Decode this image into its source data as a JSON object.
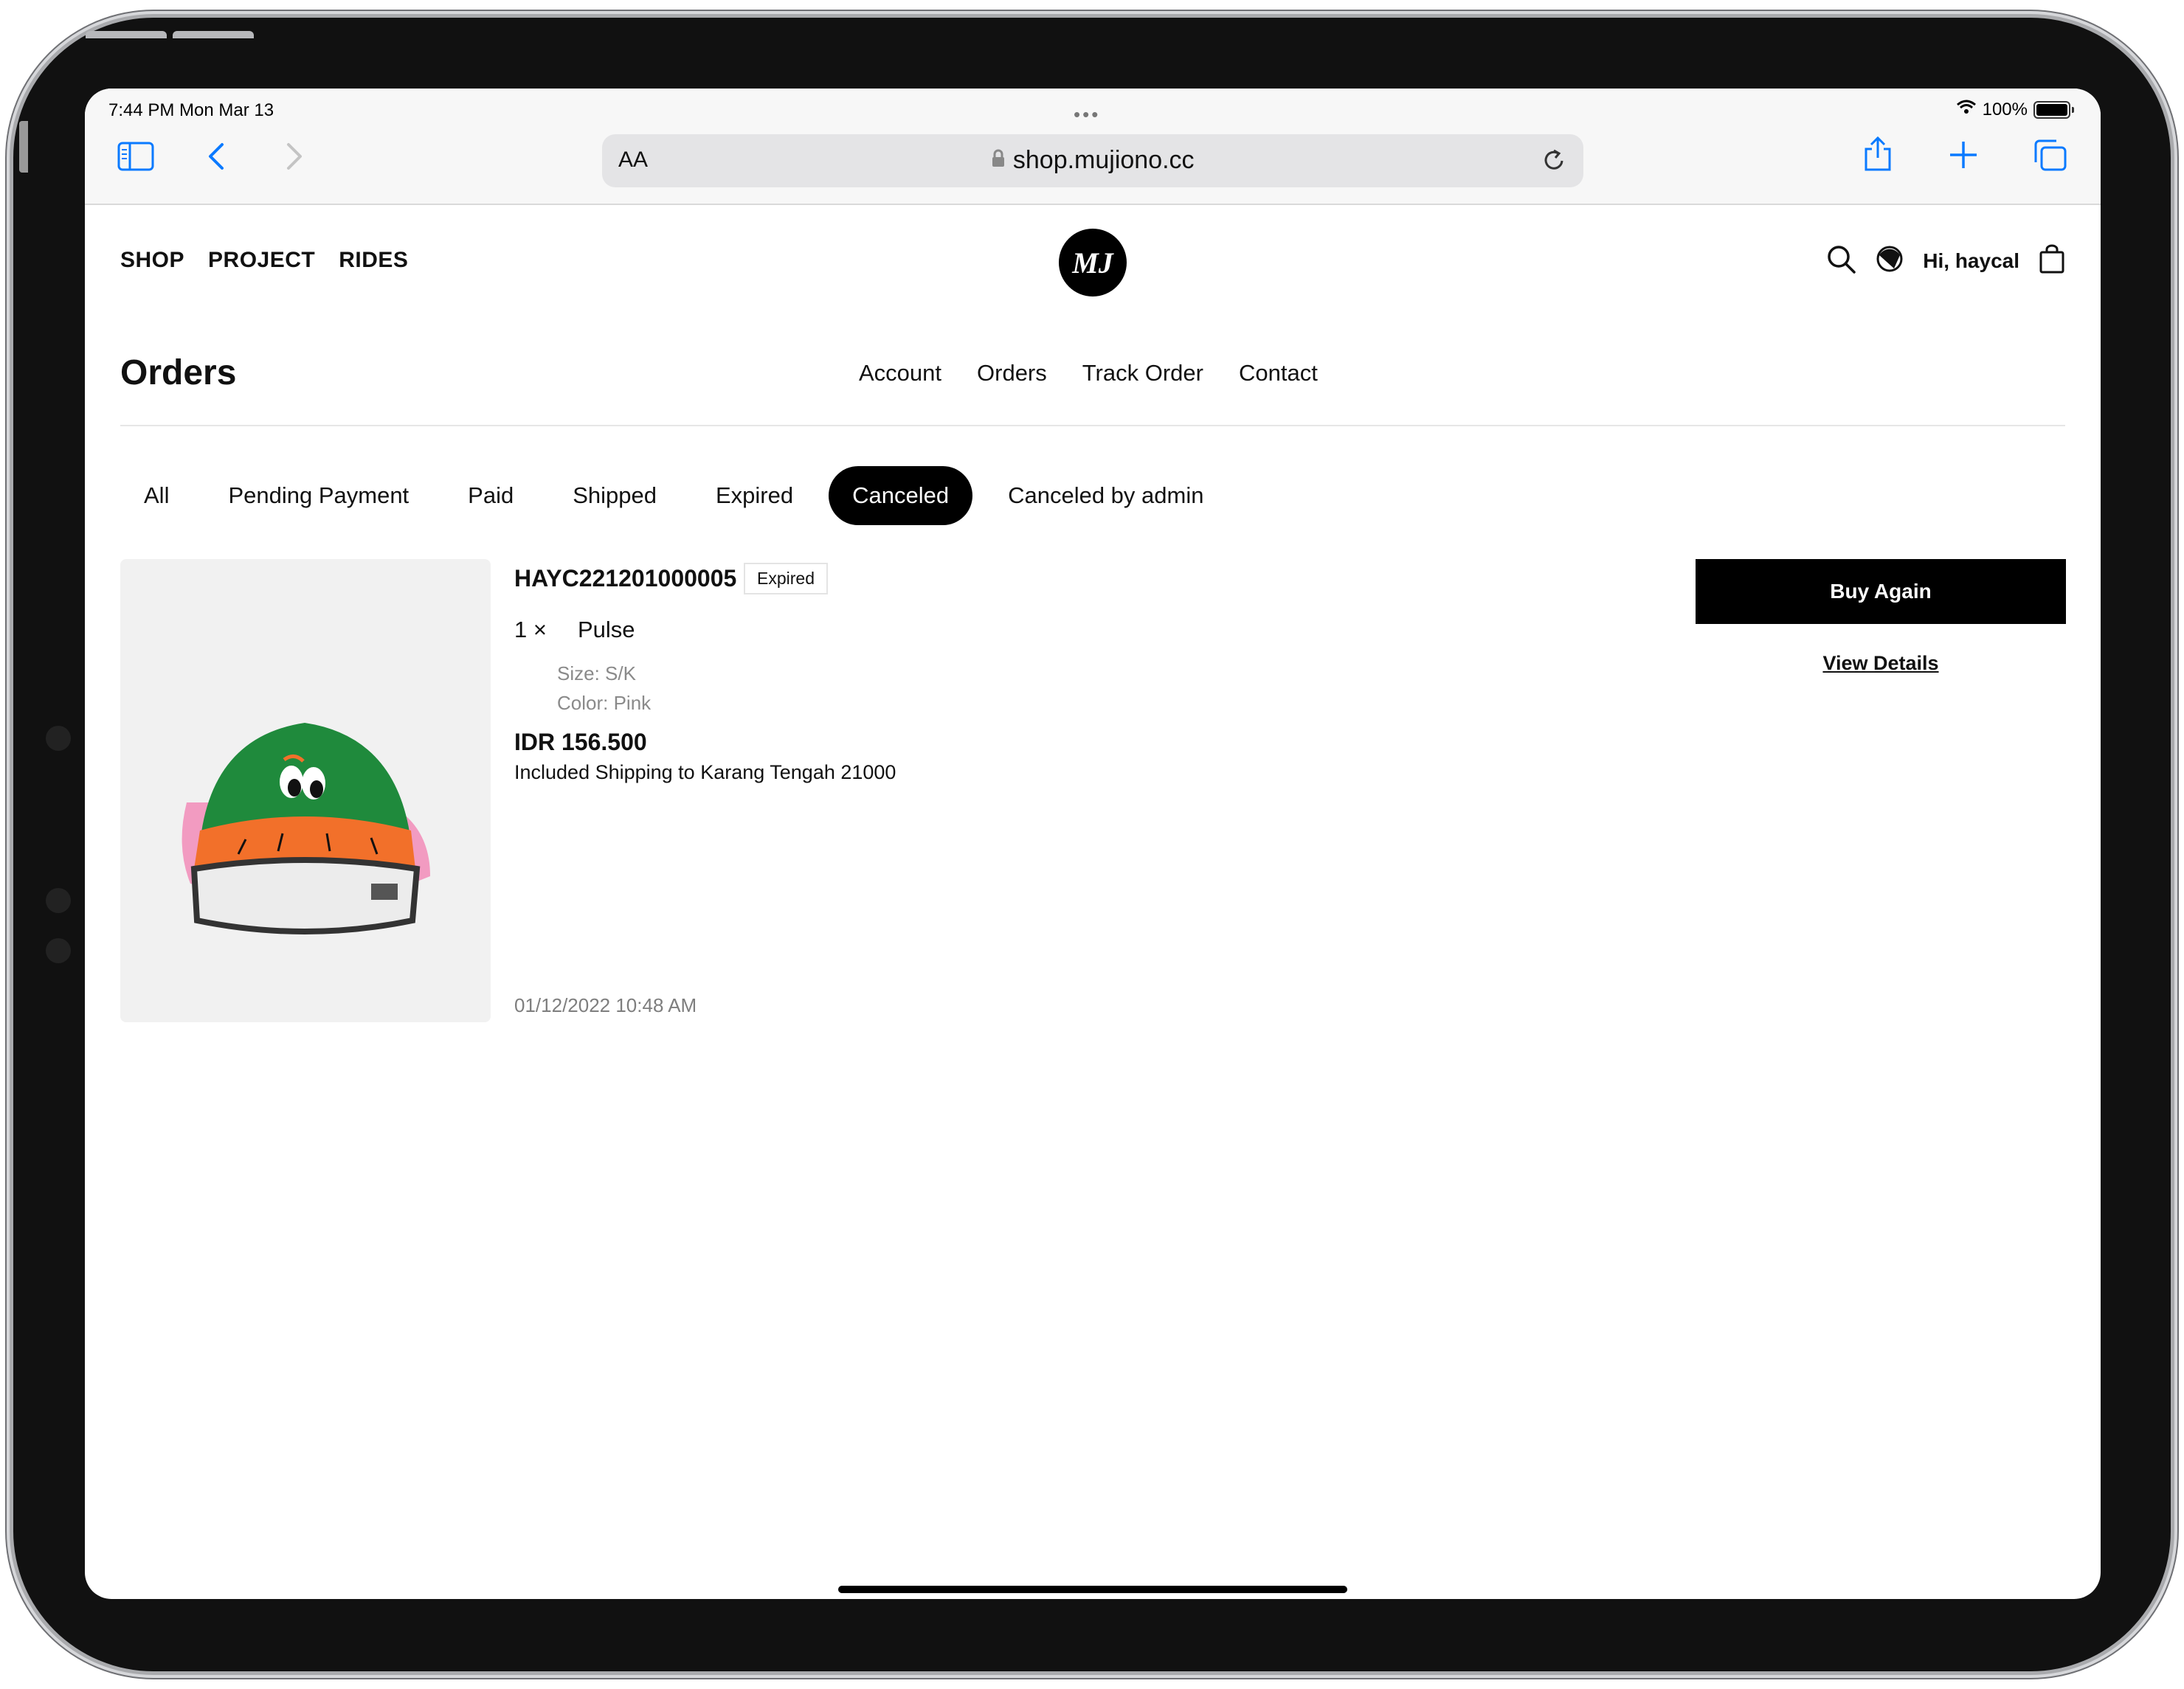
{
  "status_bar": {
    "time": "7:44 PM   Mon Mar 13",
    "battery": "100%"
  },
  "browser": {
    "aa_label": "AA",
    "url": "shop.mujiono.cc"
  },
  "site_nav": {
    "items": [
      "SHOP",
      "PROJECT",
      "RIDES"
    ]
  },
  "logo_text": "MJ",
  "header": {
    "greeting": "Hi, haycal"
  },
  "page": {
    "title": "Orders"
  },
  "account_nav": {
    "items": [
      "Account",
      "Orders",
      "Track Order",
      "Contact"
    ]
  },
  "tabs": {
    "items": [
      "All",
      "Pending Payment",
      "Paid",
      "Shipped",
      "Expired",
      "Canceled",
      "Canceled by admin"
    ],
    "active": "Canceled"
  },
  "order": {
    "id": "HAYC221201000005",
    "status": "Expired",
    "quantity": "1 ×",
    "item_name": "Pulse",
    "size": "Size: S/K",
    "color": "Color: Pink",
    "price": "IDR 156.500",
    "shipping": "Included Shipping to Karang Tengah 21000",
    "date": "01/12/2022 10:48 AM",
    "buy_again_label": "Buy Again",
    "view_details_label": "View Details"
  },
  "colors": {
    "accent": "#000000",
    "browser_tint": "#0a7aff",
    "cap_green": "#1f8a3c",
    "cap_orange": "#f2702a",
    "cap_pink": "#f29bc1"
  }
}
